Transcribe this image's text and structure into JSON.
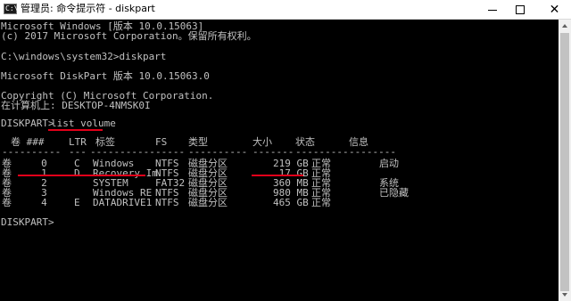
{
  "window": {
    "icon_text": "C:\\",
    "title": "管理员: 命令提示符 - diskpart",
    "minimize_glyph": "—",
    "maximize_glyph": "☐",
    "close_glyph": "✕"
  },
  "console": {
    "version_line": "Microsoft Windows [版本 10.0.15063]",
    "copyright_line": "(c) 2017 Microsoft Corporation。保留所有权利。",
    "prompt_line": "C:\\windows\\system32>diskpart",
    "diskpart_version": "Microsoft DiskPart 版本 10.0.15063.0",
    "diskpart_copyright": "Copyright (C) Microsoft Corporation.",
    "computer_line": "在计算机上: DESKTOP-4NMSK0I",
    "command_prompt": "DISKPART> ",
    "command": "list volume",
    "final_prompt": "DISKPART>"
  },
  "volume_table": {
    "headers": {
      "vol": "卷 ###",
      "ltr": "LTR",
      "label": "标签",
      "fs": "FS",
      "type": "类型",
      "size": "大小",
      "status": "状态",
      "info": "信息"
    },
    "separators": {
      "vol": "----------",
      "ltr": "---",
      "label": "-----------",
      "fs": "-----",
      "type": "----------",
      "size": "-------",
      "status": "---------",
      "info": "--------"
    },
    "rows": [
      {
        "vol": "卷     0",
        "ltr": "C",
        "label": "Windows",
        "fs": "NTFS",
        "type": "磁盘分区",
        "size": "219 GB",
        "status": "正常",
        "info": "启动"
      },
      {
        "vol": "卷     1",
        "ltr": "D",
        "label": "Recovery Im",
        "fs": "NTFS",
        "type": "磁盘分区",
        "size": " 17 GB",
        "status": "正常",
        "info": ""
      },
      {
        "vol": "卷     2",
        "ltr": "",
        "label": "SYSTEM",
        "fs": "FAT32",
        "type": "磁盘分区",
        "size": "360 MB",
        "status": "正常",
        "info": "系统"
      },
      {
        "vol": "卷     3",
        "ltr": "",
        "label": "Windows RE",
        "fs": "NTFS",
        "type": "磁盘分区",
        "size": "980 MB",
        "status": "正常",
        "info": "已隐藏"
      },
      {
        "vol": "卷     4",
        "ltr": "E",
        "label": "DATADRIVE1",
        "fs": "NTFS",
        "type": "磁盘分区",
        "size": "465 GB",
        "status": "正常",
        "info": ""
      }
    ]
  },
  "colors": {
    "console_bg": "#000000",
    "console_text": "#c0c0c0",
    "annotation": "#e2001a"
  }
}
